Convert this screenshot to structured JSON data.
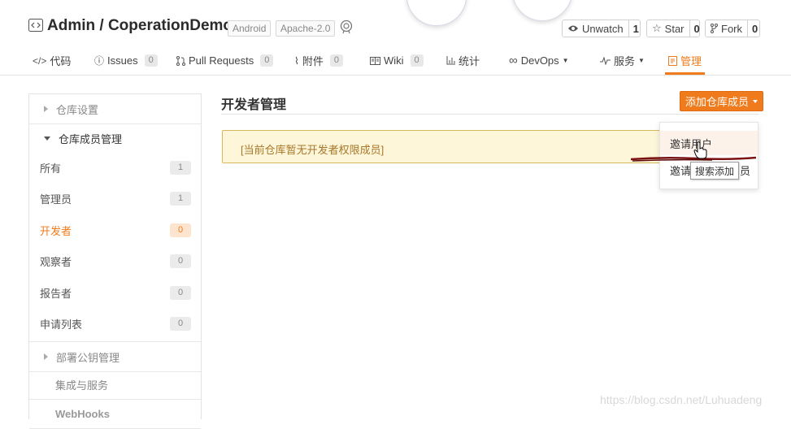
{
  "repo": {
    "title": "Admin / CoperationDemo",
    "tags": [
      "Android",
      "Apache-2.0"
    ]
  },
  "actions": {
    "watch": {
      "label": "Unwatch",
      "count": "1"
    },
    "star": {
      "label": "Star",
      "count": "0"
    },
    "fork": {
      "label": "Fork",
      "count": "0"
    }
  },
  "tabs": [
    {
      "label": "代码",
      "icon": "code-icon"
    },
    {
      "label": "Issues",
      "count": "0",
      "icon": "issue-icon"
    },
    {
      "label": "Pull Requests",
      "count": "0",
      "icon": "pull-request-icon"
    },
    {
      "label": "附件",
      "count": "0",
      "icon": "paperclip-icon"
    },
    {
      "label": "Wiki",
      "count": "0",
      "icon": "book-icon"
    },
    {
      "label": "统计",
      "icon": "bar-chart-icon"
    },
    {
      "label": "DevOps",
      "icon": "infinity-icon"
    },
    {
      "label": "服务",
      "icon": "pulse-icon"
    },
    {
      "label": "管理",
      "icon": "settings-doc-icon"
    }
  ],
  "sidebar": {
    "repo_settings": "仓库设置",
    "member_mgmt": "仓库成员管理",
    "items": [
      {
        "label": "所有",
        "count": "1"
      },
      {
        "label": "管理员",
        "count": "1"
      },
      {
        "label": "开发者",
        "count": "0"
      },
      {
        "label": "观察者",
        "count": "0"
      },
      {
        "label": "报告者",
        "count": "0"
      },
      {
        "label": "申请列表",
        "count": "0"
      }
    ],
    "deploy_keys": "部署公钥管理",
    "integrations": "集成与服务",
    "webhooks": "WebHooks"
  },
  "main": {
    "title": "开发者管理",
    "add_button": "添加仓库成员",
    "notice": "[当前仓库暂无开发者权限成员]"
  },
  "dropdown": {
    "items": [
      "邀请用户",
      "邀请",
      "员"
    ],
    "tooltip": "搜索添加"
  },
  "watermark": "https://blog.csdn.net/Luhuadeng",
  "colors": {
    "accent": "#f07b1c",
    "notice_bg": "#fdf6d8",
    "notice_border": "#d9b85a"
  }
}
